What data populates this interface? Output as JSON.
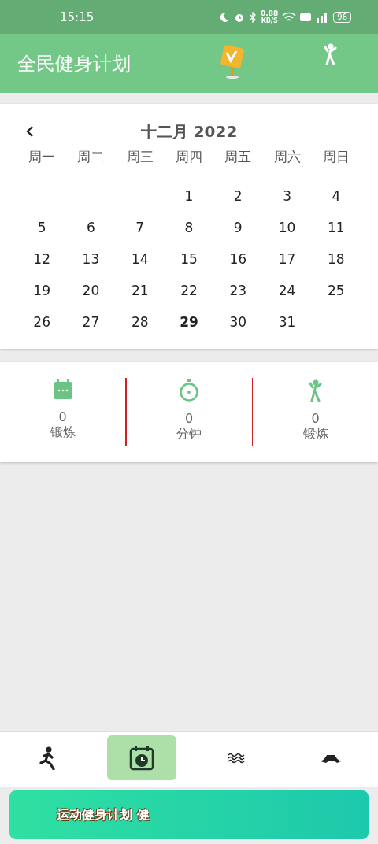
{
  "status_bar": {
    "time": "15:15",
    "speed": "0.88",
    "speed_unit": "KB/S",
    "battery": "96"
  },
  "app_bar": {
    "title": "全民健身计划"
  },
  "calendar": {
    "month": "十二月 2022",
    "weekdays": [
      "周一",
      "周二",
      "周三",
      "周四",
      "周五",
      "周六",
      "周日"
    ],
    "days": [
      {
        "label": "1",
        "today": false
      },
      {
        "label": "2",
        "today": false
      },
      {
        "label": "3",
        "today": false
      },
      {
        "label": "4",
        "today": false
      },
      {
        "label": "5",
        "today": false
      },
      {
        "label": "6",
        "today": false
      },
      {
        "label": "7",
        "today": false
      },
      {
        "label": "8",
        "today": false
      },
      {
        "label": "9",
        "today": false
      },
      {
        "label": "10",
        "today": false
      },
      {
        "label": "11",
        "today": false
      },
      {
        "label": "12",
        "today": false
      },
      {
        "label": "13",
        "today": false
      },
      {
        "label": "14",
        "today": false
      },
      {
        "label": "15",
        "today": false
      },
      {
        "label": "16",
        "today": false
      },
      {
        "label": "17",
        "today": false
      },
      {
        "label": "18",
        "today": false
      },
      {
        "label": "19",
        "today": false
      },
      {
        "label": "20",
        "today": false
      },
      {
        "label": "21",
        "today": false
      },
      {
        "label": "22",
        "today": false
      },
      {
        "label": "23",
        "today": false
      },
      {
        "label": "24",
        "today": false
      },
      {
        "label": "25",
        "today": false
      },
      {
        "label": "26",
        "today": false
      },
      {
        "label": "27",
        "today": false
      },
      {
        "label": "28",
        "today": false
      },
      {
        "label": "29",
        "today": true
      },
      {
        "label": "30",
        "today": false
      },
      {
        "label": "31",
        "today": false
      }
    ]
  },
  "stats": [
    {
      "kind": "calendar",
      "value": "0",
      "label": "锻炼"
    },
    {
      "kind": "stopwatch",
      "value": "0",
      "label": "分钟"
    },
    {
      "kind": "figure",
      "value": "0",
      "label": "锻炼"
    }
  ],
  "bottom_nav": [
    {
      "kind": "runner",
      "selected": false
    },
    {
      "kind": "calendar",
      "selected": true
    },
    {
      "kind": "waves",
      "selected": false
    },
    {
      "kind": "hat",
      "selected": false
    }
  ],
  "banner": {
    "title": "运动健身计划 健"
  }
}
